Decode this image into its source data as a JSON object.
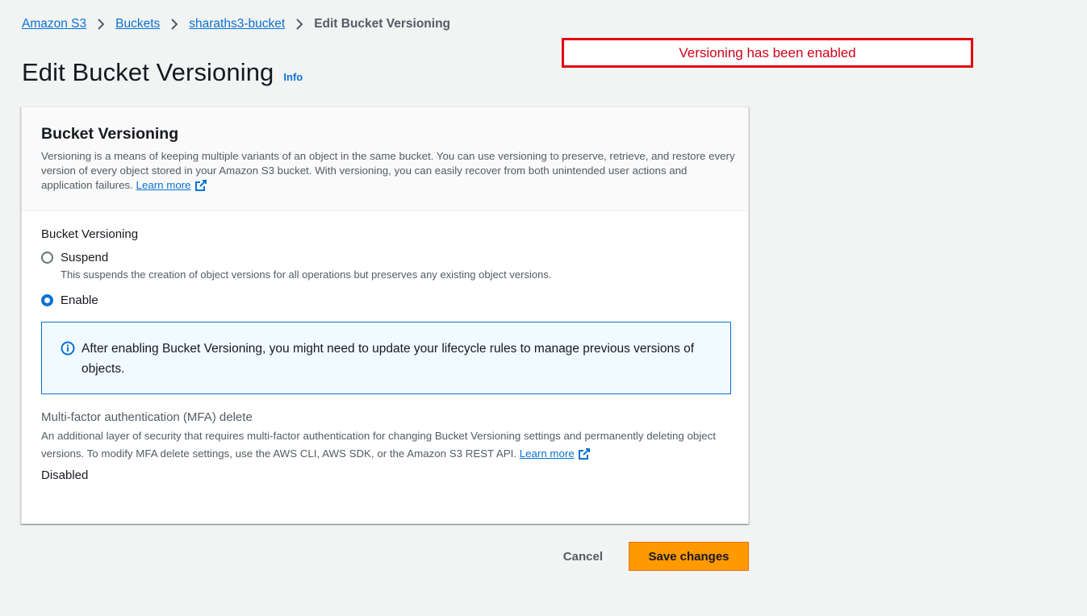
{
  "breadcrumb": {
    "items": [
      "Amazon S3",
      "Buckets",
      "sharaths3-bucket"
    ],
    "current": "Edit Bucket Versioning"
  },
  "page": {
    "title": "Edit Bucket Versioning",
    "info_label": "Info"
  },
  "annotation": {
    "text": "Versioning has been enabled",
    "color": "#e3000f"
  },
  "panel": {
    "title": "Bucket Versioning",
    "description": "Versioning is a means of keeping multiple variants of an object in the same bucket. You can use versioning to preserve, retrieve, and restore every version of every object stored in your Amazon S3 bucket. With versioning, you can easily recover from both unintended user actions and application failures.",
    "learn_more": "Learn more"
  },
  "versioning": {
    "label": "Bucket Versioning",
    "options": [
      {
        "label": "Suspend",
        "description": "This suspends the creation of object versions for all operations but preserves any existing object versions.",
        "checked": false
      },
      {
        "label": "Enable",
        "description": "",
        "checked": true
      }
    ],
    "alert": "After enabling Bucket Versioning, you might need to update your lifecycle rules to manage previous versions of objects."
  },
  "mfa": {
    "title": "Multi-factor authentication (MFA) delete",
    "description": "An additional layer of security that requires multi-factor authentication for changing Bucket Versioning settings and permanently deleting object versions. To modify MFA delete settings, use the AWS CLI, AWS SDK, or the Amazon S3 REST API.",
    "learn_more": "Learn more",
    "status": "Disabled"
  },
  "actions": {
    "cancel": "Cancel",
    "save": "Save changes"
  },
  "colors": {
    "link": "#0972d3",
    "primary_button": "#ff9900",
    "alert_border": "#0972d3",
    "alert_bg": "#f1faff"
  }
}
